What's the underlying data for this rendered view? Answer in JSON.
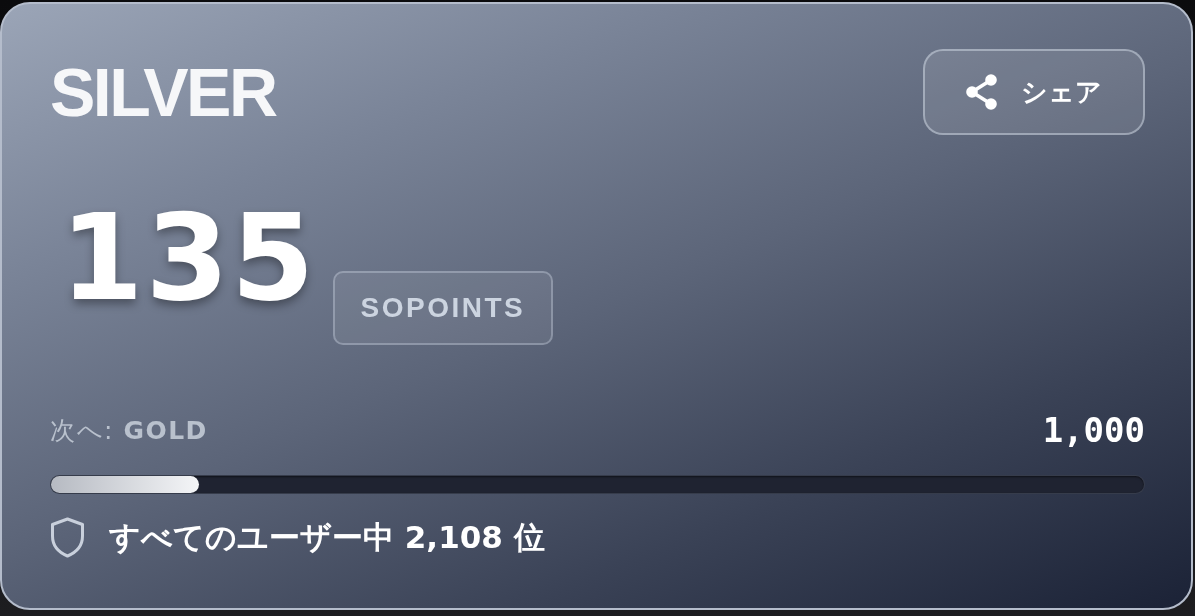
{
  "tier": "SILVER",
  "share_button": {
    "label": "シェア"
  },
  "points": {
    "value": "135",
    "unit": "SOPOINTS"
  },
  "next_tier": {
    "label": "次へ: **GOLD**",
    "target": "1,000",
    "level": 0.135
  },
  "rank": {
    "text": "すべてのユーザー中 2,108 位"
  }
}
